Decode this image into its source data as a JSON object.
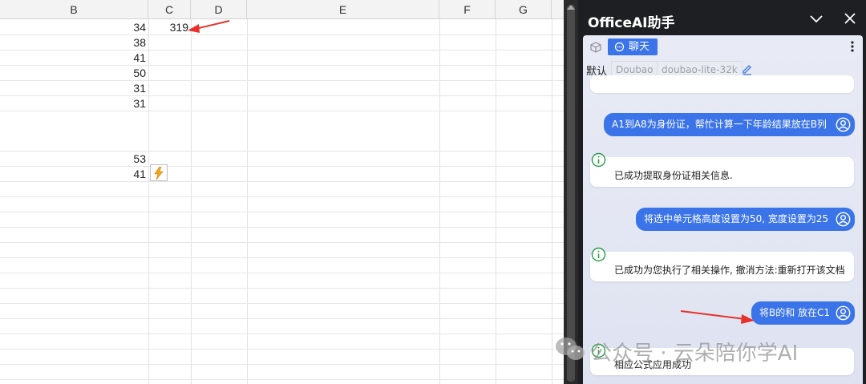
{
  "sheet": {
    "columns": [
      "B",
      "C",
      "D",
      "E",
      "F",
      "G"
    ],
    "b_values": [
      "34",
      "38",
      "41",
      "50",
      "31",
      "31",
      "53",
      "41"
    ],
    "c1_value": "319"
  },
  "panel": {
    "title": "OfficeAI助手",
    "chat_tab_label": "聊天",
    "model_label": "默认",
    "provider": "Doubao",
    "model": "doubao-lite-32k",
    "messages": [
      {
        "role": "user",
        "text": "A1到A8为身份证，帮忙计算一下年龄结果放在B列"
      },
      {
        "role": "ai",
        "text": "已成功提取身份证相关信息."
      },
      {
        "role": "user",
        "text": "将选中单元格高度设置为50, 宽度设置为25"
      },
      {
        "role": "ai",
        "text": "已成功为您执行了相关操作, 撤消方法:重新打开该文档"
      },
      {
        "role": "user",
        "text": "将B的和 放在C1"
      },
      {
        "role": "ai",
        "text": "相应公式应用成功"
      }
    ]
  },
  "watermark": {
    "text": "公众号 · 云朵陪你学AI"
  },
  "colors": {
    "accent": "#3b74e8",
    "arrow": "#e8312b",
    "success": "#2a9d4a",
    "panel_dark": "#1e1f22"
  }
}
